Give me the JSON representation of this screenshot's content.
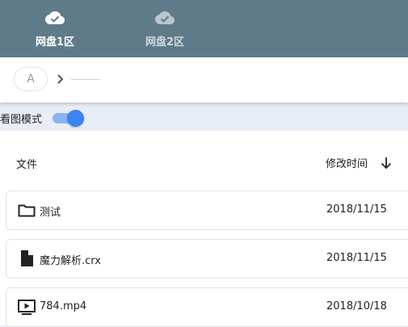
{
  "tabs": [
    {
      "label": "网盘1区",
      "icon": "cloud-check-icon",
      "active": true
    },
    {
      "label": "网盘2区",
      "icon": "cloud-check-icon",
      "active": false
    }
  ],
  "breadcrumb": {
    "root_label": "A"
  },
  "view_mode": {
    "label": "看图模式",
    "enabled": true
  },
  "list": {
    "header_file": "文件",
    "header_time": "修改时间",
    "sort_direction": "descending",
    "rows": [
      {
        "name": "测试",
        "date": "2018/11/15",
        "icon": "folder-icon"
      },
      {
        "name": "魔力解析.crx",
        "date": "2018/11/15",
        "icon": "file-icon"
      },
      {
        "name": "784.mp4",
        "date": "2018/10/18",
        "icon": "video-file-icon"
      }
    ]
  },
  "colors": {
    "header_bg": "#5f7b89",
    "toggle_accent": "#3d82f2",
    "page_bg": "#e9edf5"
  }
}
